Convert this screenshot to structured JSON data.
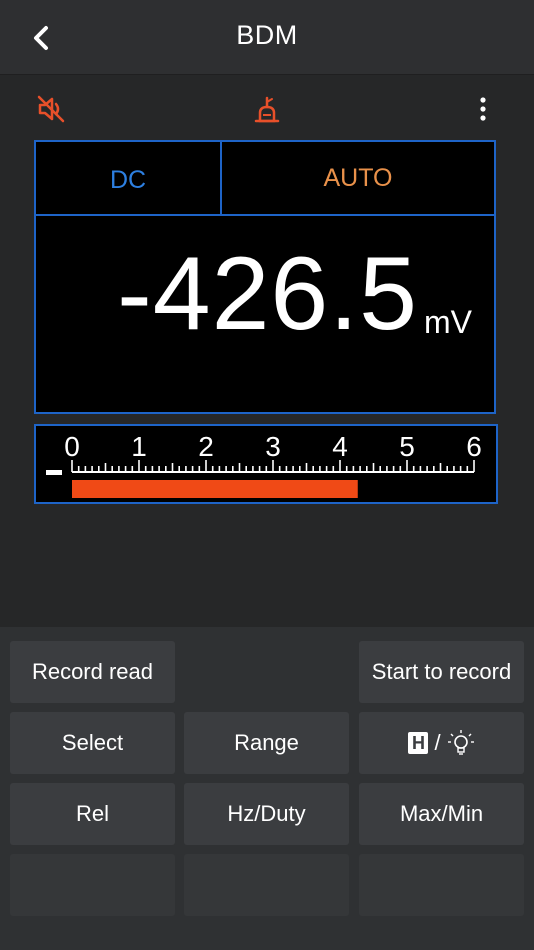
{
  "header": {
    "title": "BDM",
    "back_icon": "chevron-left-icon"
  },
  "toolbar": {
    "mute_icon": "sound-off-icon",
    "probe_icon": "probe-icon",
    "more_icon": "more-vertical-icon",
    "accent_color": "#e8502a"
  },
  "display": {
    "mode": "DC",
    "range": "AUTO",
    "value": "-426.5",
    "unit": "mV",
    "border_color": "#1e64c8"
  },
  "scale": {
    "labels": [
      "0",
      "1",
      "2",
      "3",
      "4",
      "5",
      "6"
    ],
    "min": 0,
    "max": 6,
    "bar_value": 4.265,
    "bar_color": "#f04a16"
  },
  "buttons": {
    "record_read": "Record read",
    "start_record": "Start to record",
    "select": "Select",
    "range": "Range",
    "hold_light_slash": "/",
    "hold_letter": "H",
    "rel": "Rel",
    "hz_duty": "Hz/Duty",
    "max_min": "Max/Min"
  }
}
